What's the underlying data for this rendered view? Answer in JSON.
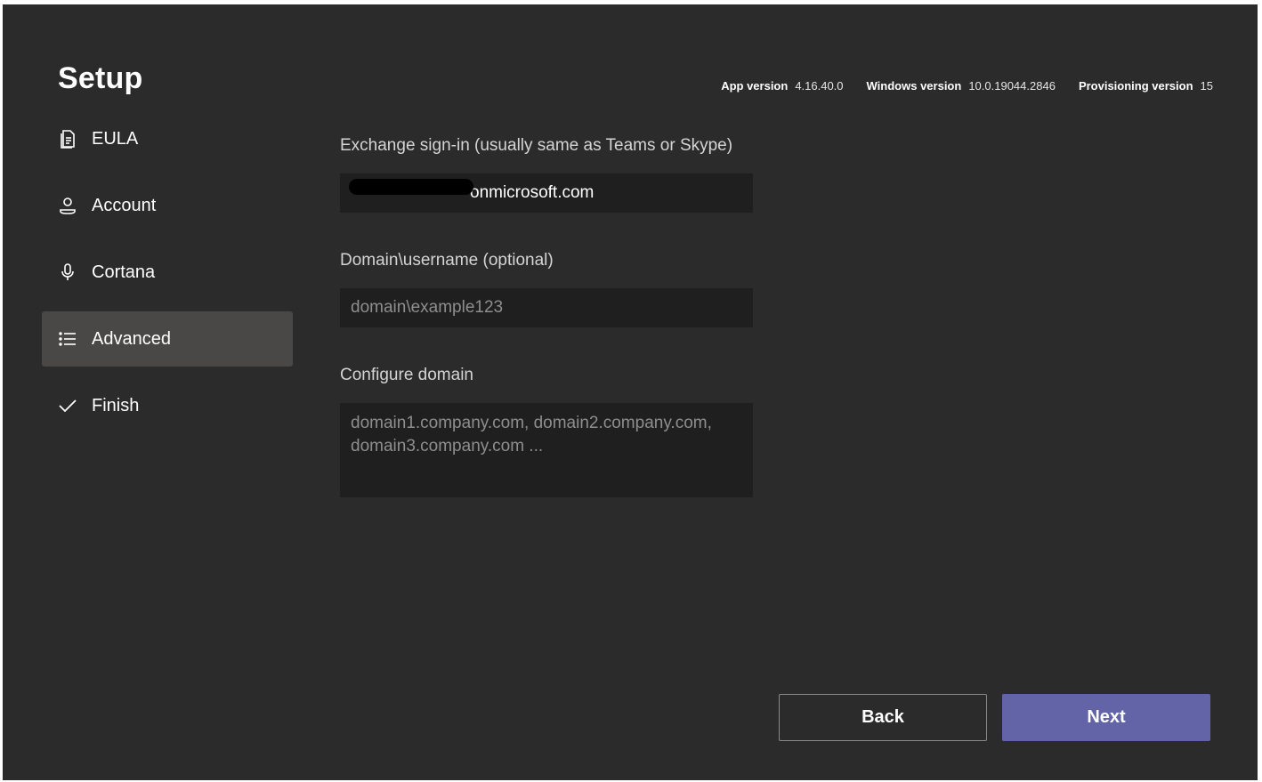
{
  "header": {
    "title": "Setup",
    "versions": [
      {
        "label": "App version",
        "value": "4.16.40.0"
      },
      {
        "label": "Windows version",
        "value": "10.0.19044.2846"
      },
      {
        "label": "Provisioning version",
        "value": "15"
      }
    ]
  },
  "sidebar": {
    "items": [
      {
        "label": "EULA",
        "icon": "document-icon",
        "active": false
      },
      {
        "label": "Account",
        "icon": "person-icon",
        "active": false
      },
      {
        "label": "Cortana",
        "icon": "microphone-icon",
        "active": false
      },
      {
        "label": "Advanced",
        "icon": "list-icon",
        "active": true
      },
      {
        "label": "Finish",
        "icon": "checkmark-icon",
        "active": false
      }
    ]
  },
  "form": {
    "exchange": {
      "label": "Exchange sign-in (usually same as Teams or Skype)",
      "value": "onmicrosoft.com"
    },
    "domain_username": {
      "label": "Domain\\username (optional)",
      "placeholder": "domain\\example123",
      "value": ""
    },
    "configure_domain": {
      "label": "Configure domain",
      "placeholder": "domain1.company.com, domain2.company.com, domain3.company.com ...",
      "value": ""
    }
  },
  "footer": {
    "back_label": "Back",
    "next_label": "Next"
  },
  "colors": {
    "background": "#2b2b2b",
    "accent": "#6264a7",
    "active_nav": "#4a4847",
    "input_bg": "#1f1f1f"
  }
}
